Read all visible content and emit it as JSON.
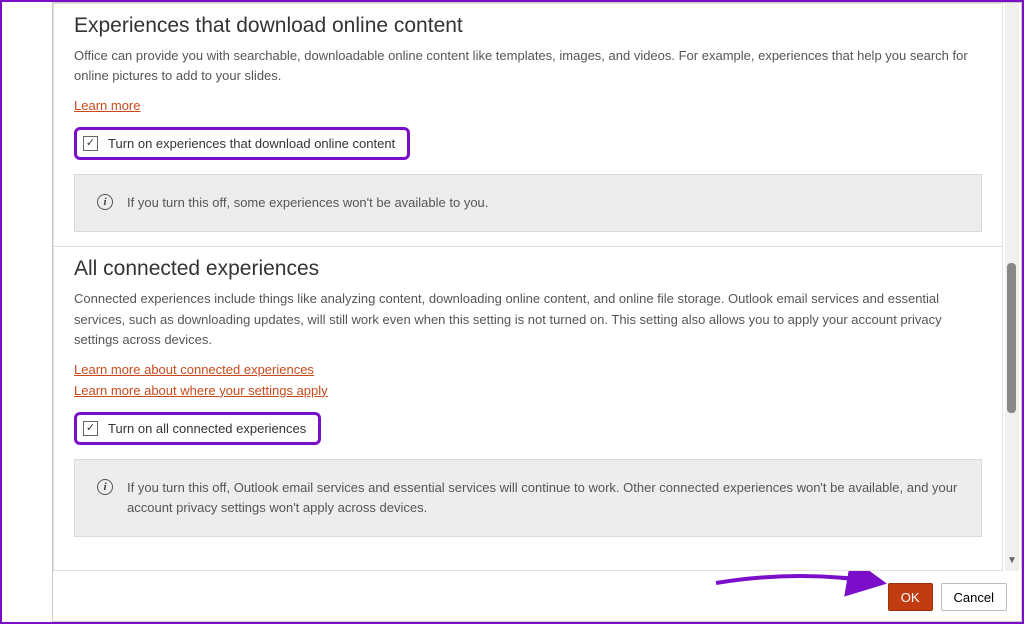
{
  "section1": {
    "heading": "Experiences that download online content",
    "description": "Office can provide you with searchable, downloadable online content like templates, images, and videos. For example, experiences that help you search for online pictures to add to your slides.",
    "learn_more": "Learn more",
    "checkbox_label": "Turn on experiences that download online content",
    "info": "If you turn this off, some experiences won't be available to you."
  },
  "section2": {
    "heading": "All connected experiences",
    "description": "Connected experiences include things like analyzing content, downloading online content, and online file storage. Outlook email services and essential services, such as downloading updates, will still work even when this setting is not turned on. This setting also allows you to apply your account privacy settings across devices.",
    "link1": "Learn more about connected experiences",
    "link2": "Learn more about where your settings apply",
    "checkbox_label": "Turn on all connected experiences",
    "info": "If you turn this off, Outlook email services and essential services will continue to work. Other connected experiences won't be available, and your account privacy settings won't apply across devices."
  },
  "buttons": {
    "ok": "OK",
    "cancel": "Cancel"
  },
  "checkmark": "✓"
}
